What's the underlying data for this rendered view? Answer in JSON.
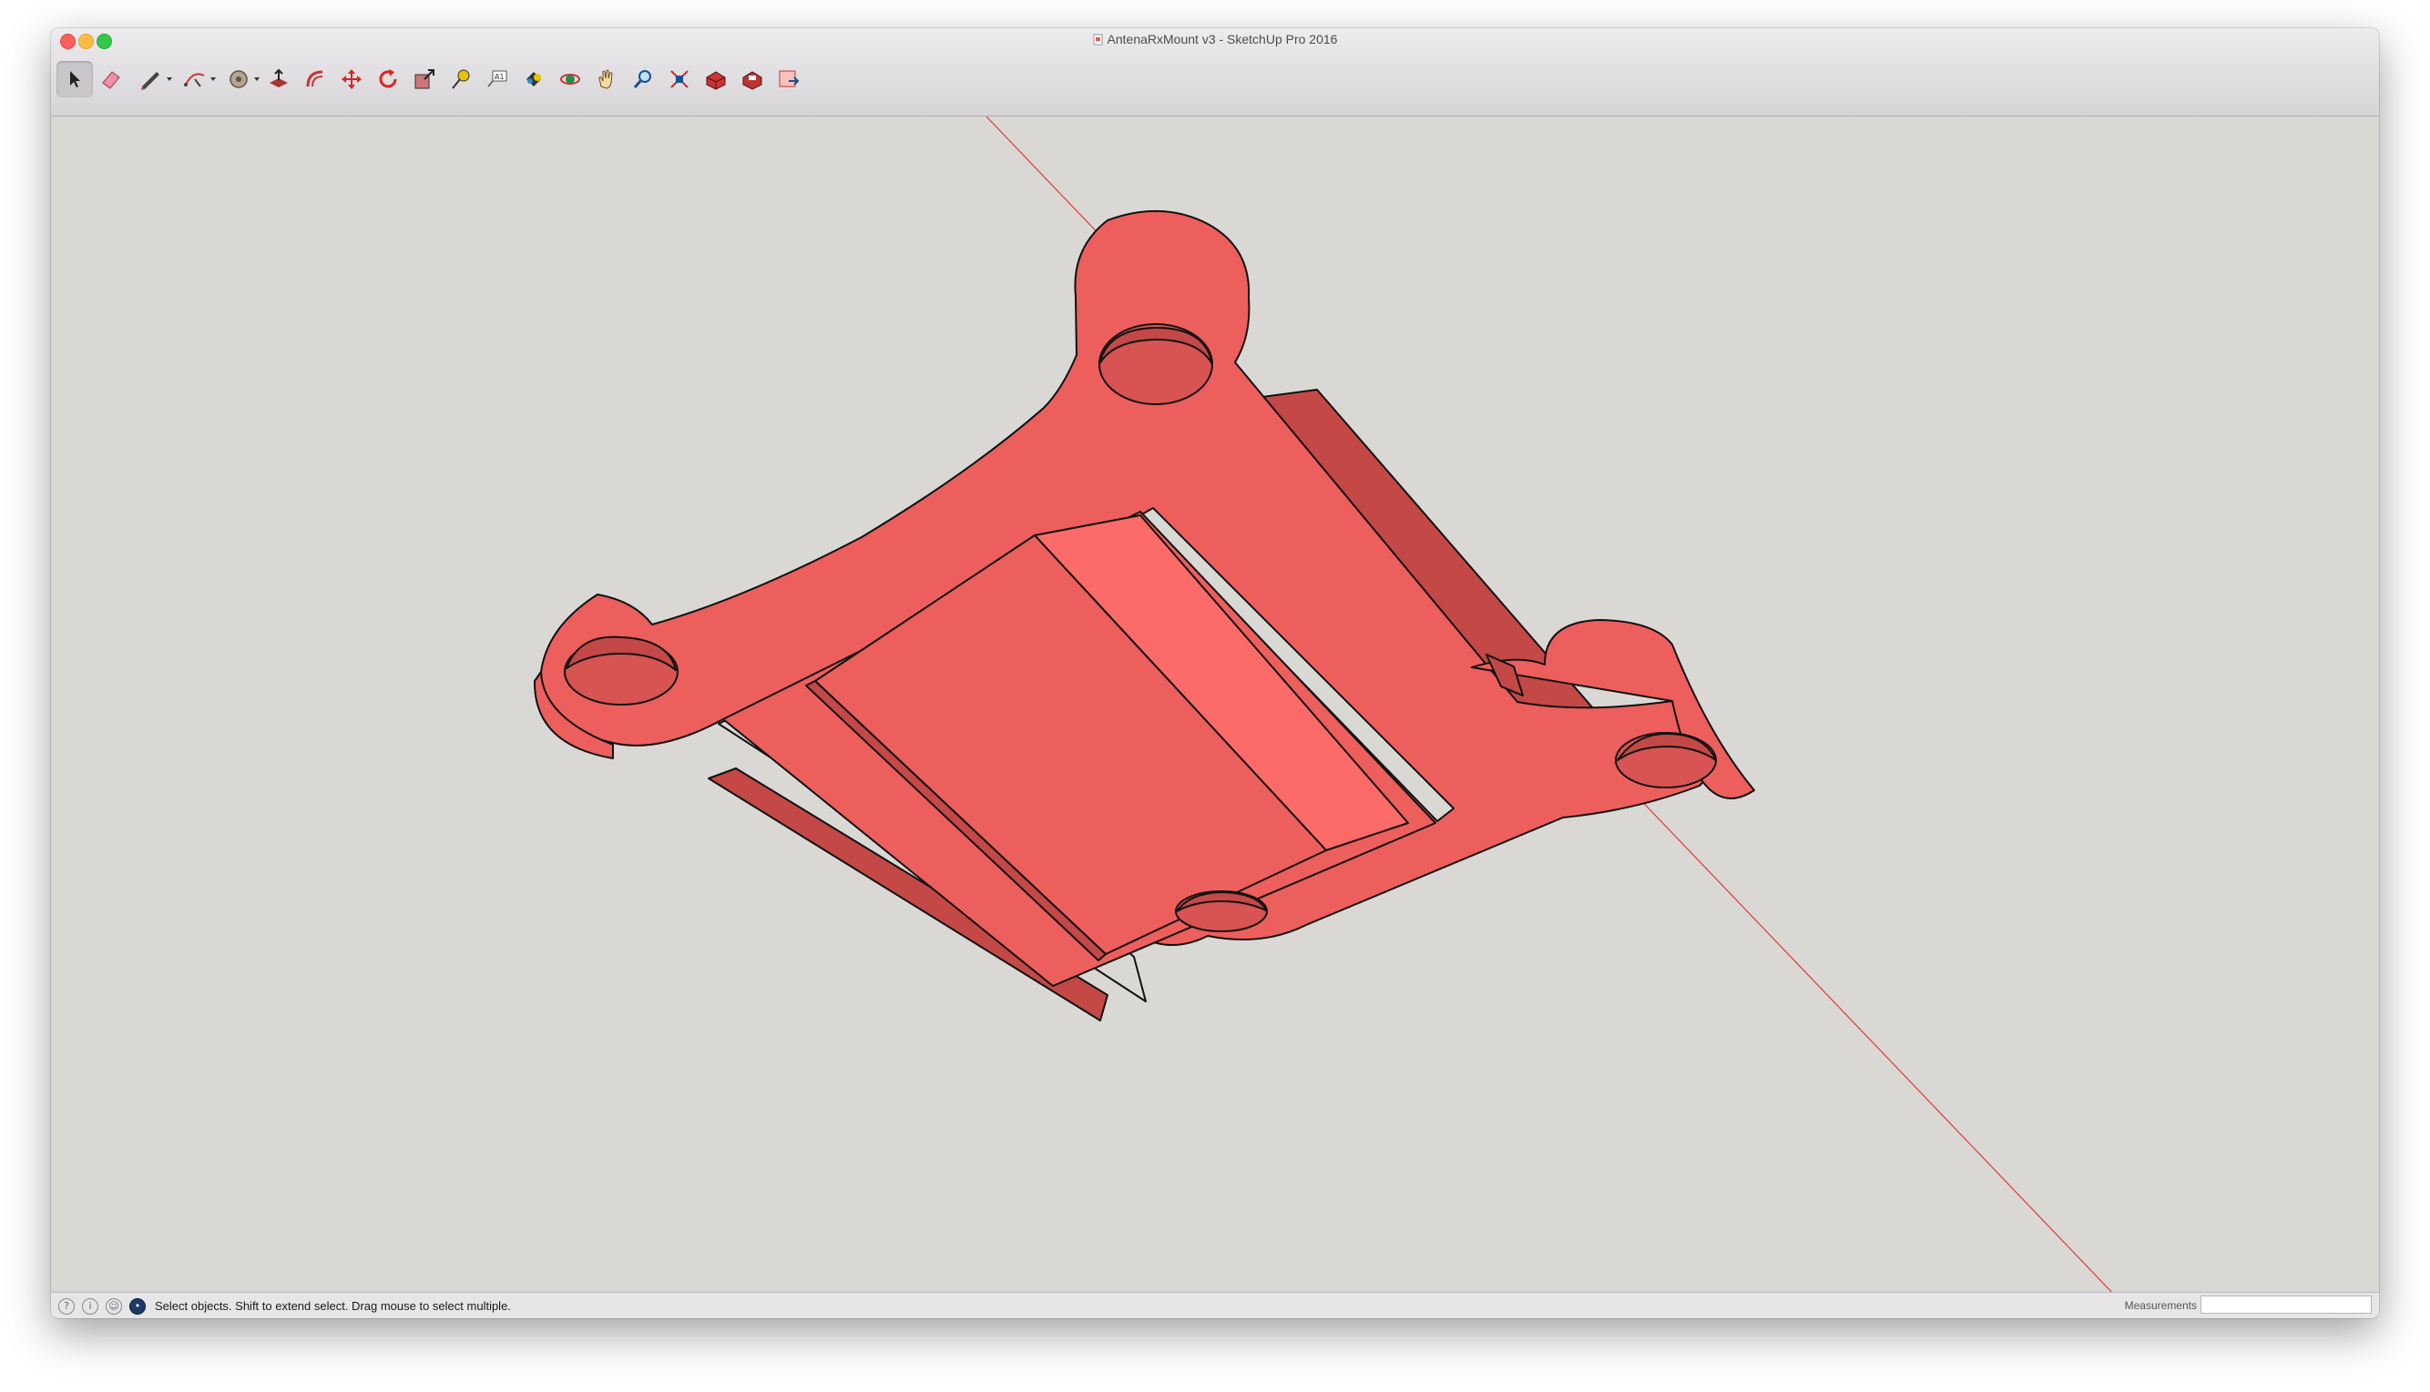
{
  "window": {
    "title": "AntenaRxMount v3 - SketchUp Pro 2016"
  },
  "toolbar": {
    "tools": [
      {
        "name": "select",
        "icon": "select-arrow-icon",
        "selected": true
      },
      {
        "name": "eraser",
        "icon": "eraser-icon"
      },
      {
        "name": "line",
        "icon": "pencil-icon",
        "dropdown": true
      },
      {
        "name": "arc",
        "icon": "arc-icon",
        "dropdown": true
      },
      {
        "name": "shapes",
        "icon": "polygon-icon",
        "dropdown": true
      },
      {
        "name": "push-pull",
        "icon": "push-pull-icon"
      },
      {
        "name": "offset",
        "icon": "offset-icon"
      },
      {
        "name": "move",
        "icon": "move-icon"
      },
      {
        "name": "rotate",
        "icon": "rotate-icon"
      },
      {
        "name": "scale",
        "icon": "scale-icon"
      },
      {
        "name": "tape-measure",
        "icon": "tape-measure-icon"
      },
      {
        "name": "text",
        "icon": "text-icon"
      },
      {
        "name": "paint-bucket",
        "icon": "paint-bucket-icon"
      },
      {
        "name": "orbit",
        "icon": "orbit-icon"
      },
      {
        "name": "pan",
        "icon": "pan-hand-icon"
      },
      {
        "name": "zoom",
        "icon": "zoom-icon"
      },
      {
        "name": "zoom-extents",
        "icon": "zoom-extents-icon"
      },
      {
        "name": "3d-warehouse",
        "icon": "warehouse-icon"
      },
      {
        "name": "extension-warehouse",
        "icon": "extension-warehouse-icon"
      },
      {
        "name": "layout",
        "icon": "send-to-layout-icon"
      }
    ]
  },
  "colors": {
    "model_face": "#ed5f5c",
    "model_face_light": "#fc6b67",
    "model_face_dark": "#c34846",
    "axis_red": "#e0393a",
    "viewport_bg": "#dad8d4"
  },
  "statusbar": {
    "message": "Select objects. Shift to extend select. Drag mouse to select multiple.",
    "measurements_label": "Measurements",
    "measurements_value": ""
  }
}
